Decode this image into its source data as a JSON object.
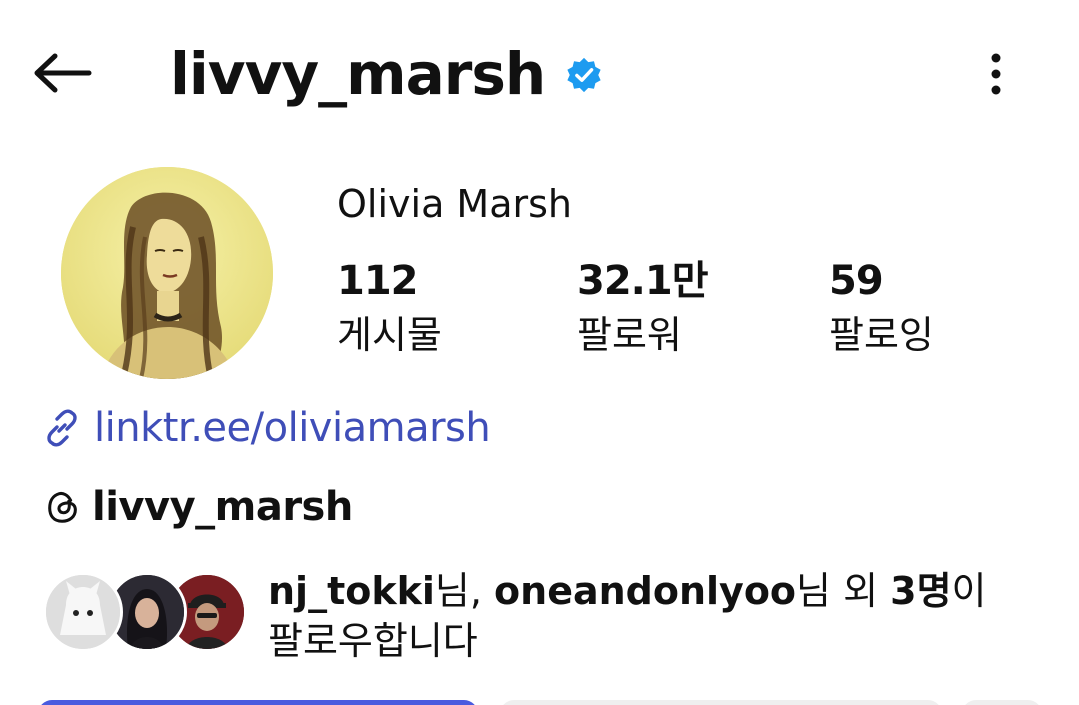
{
  "header": {
    "username": "livvy_marsh",
    "verified": true,
    "back_icon": "arrow-left-icon",
    "more_icon": "more-vertical-icon"
  },
  "profile": {
    "display_name": "Olivia Marsh",
    "stats": [
      {
        "value": "112",
        "label": "게시물"
      },
      {
        "value": "32.1만",
        "label": "팔로워"
      },
      {
        "value": "59",
        "label": "팔로잉"
      }
    ],
    "link": "linktr.ee/oliviamarsh",
    "threads_handle": "livvy_marsh"
  },
  "followed_by": {
    "user1": "nj_tokki",
    "sep1": "님, ",
    "user2": "oneandonlyoo",
    "sep2": "님 외 ",
    "count": "3명",
    "tail1": "이",
    "line2": "팔로우합니다"
  },
  "colors": {
    "link": "#3f4eb8",
    "verified": "#1d9bf0",
    "primary_button": "#4a5bdf",
    "secondary_button": "#efefef"
  }
}
